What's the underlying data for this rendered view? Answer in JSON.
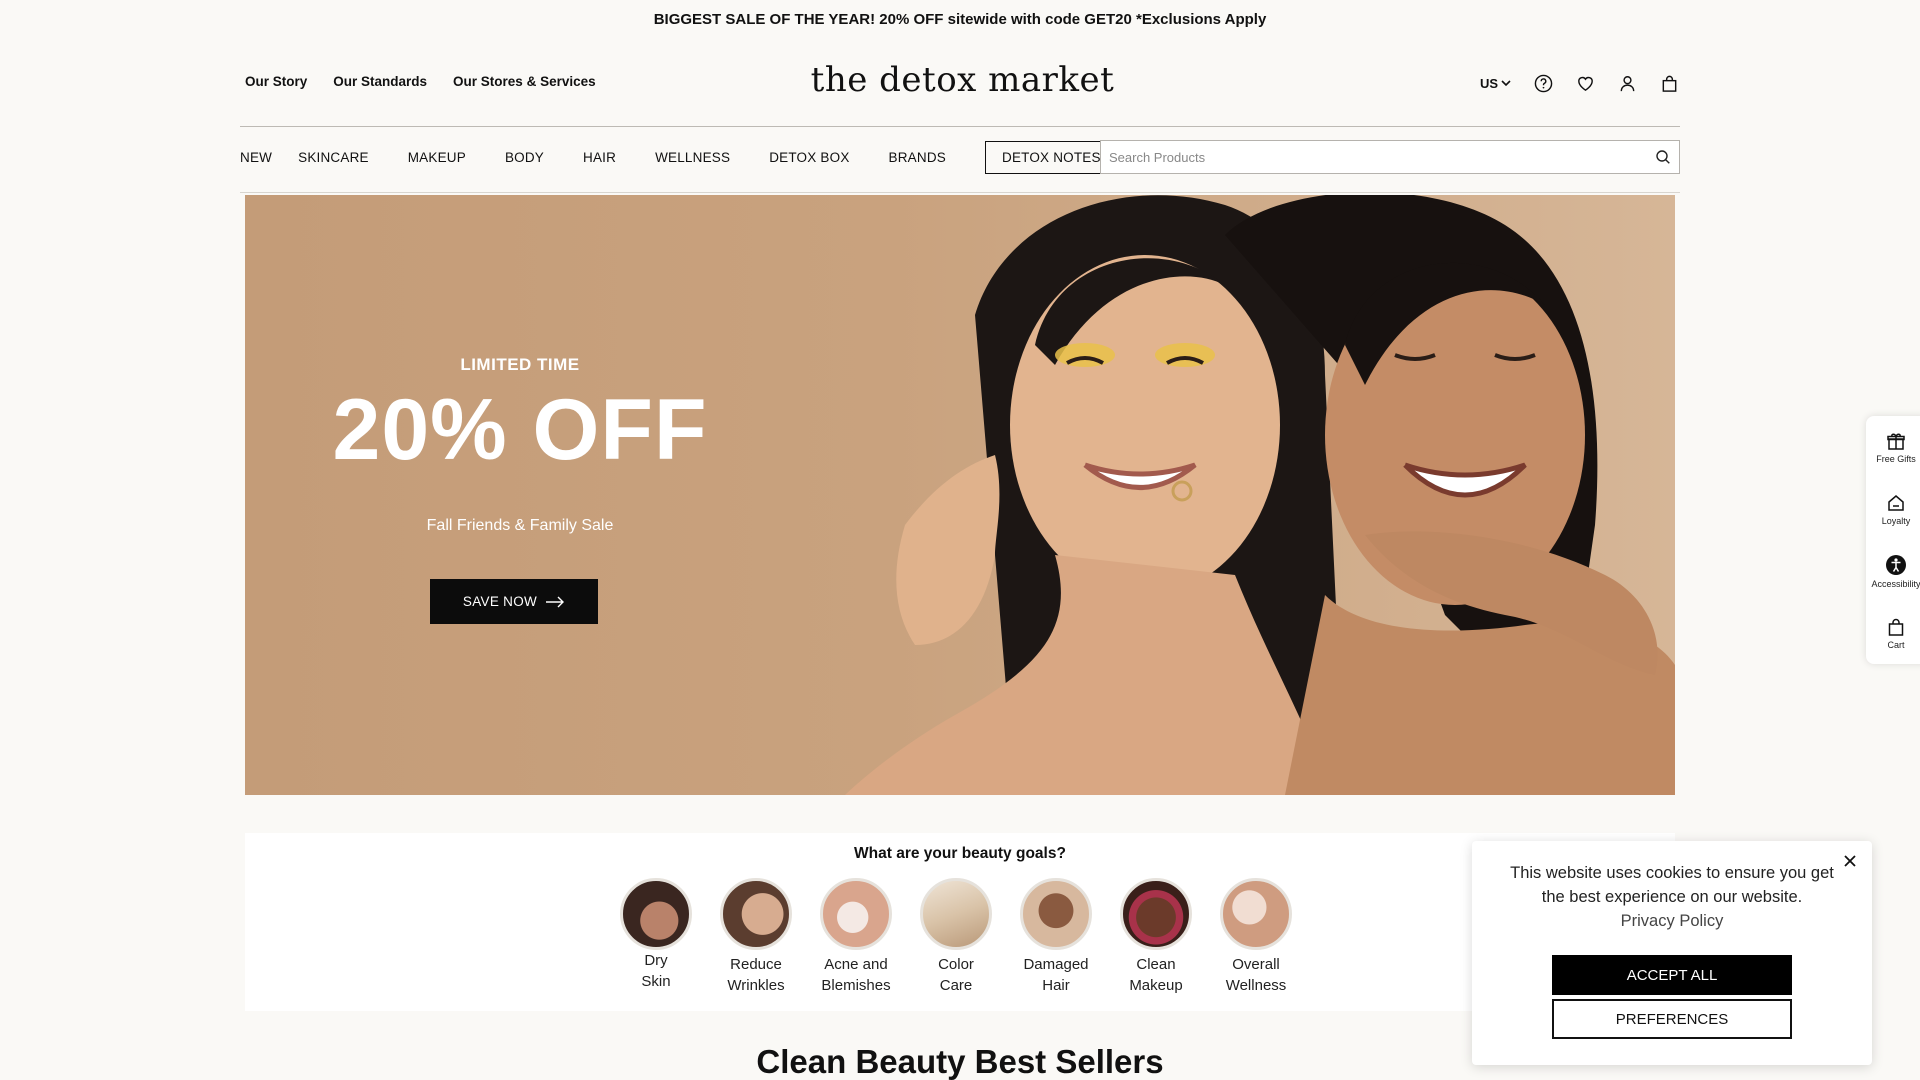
{
  "announcement": "BIGGEST SALE OF THE YEAR! 20% OFF sitewide with code GET20 *Exclusions Apply",
  "header": {
    "logo": "the detox market",
    "util_links": [
      "Our Story",
      "Our Standards",
      "Our Stores & Services"
    ],
    "country": "US",
    "icons": [
      "help-icon",
      "heart-icon",
      "account-icon",
      "bag-icon"
    ]
  },
  "nav": {
    "items": [
      "NEW",
      "SKINCARE",
      "MAKEUP",
      "BODY",
      "HAIR",
      "WELLNESS",
      "DETOX BOX",
      "BRANDS"
    ],
    "notes": "DETOX NOTES",
    "search_placeholder": "Search Products"
  },
  "hero": {
    "eyebrow": "LIMITED TIME",
    "headline": "20% OFF",
    "subtitle": "Fall Friends & Family Sale",
    "cta": "SAVE NOW"
  },
  "goals": {
    "title": "What are your beauty goals?",
    "items": [
      {
        "line1": "Dry",
        "line2": "Skin"
      },
      {
        "line1": "Reduce",
        "line2": "Wrinkles"
      },
      {
        "line1": "Acne and",
        "line2": "Blemishes"
      },
      {
        "line1": "Color",
        "line2": "Care"
      },
      {
        "line1": "Damaged",
        "line2": "Hair"
      },
      {
        "line1": "Clean",
        "line2": "Makeup"
      },
      {
        "line1": "Overall",
        "line2": "Wellness"
      }
    ]
  },
  "best_sellers_title": "Clean Beauty Best Sellers",
  "side_widget": {
    "items": [
      {
        "label": "Free Gifts",
        "icon": "gift-icon"
      },
      {
        "label": "Loyalty",
        "icon": "loyalty-icon"
      },
      {
        "label": "Accessibility",
        "icon": "accessibility-icon"
      },
      {
        "label": "Cart",
        "icon": "cart-icon"
      }
    ]
  },
  "cookie": {
    "message": "This website uses cookies to ensure you get the best experience on our website.",
    "link": "Privacy Policy",
    "accept": "ACCEPT ALL",
    "preferences": "PREFERENCES"
  }
}
